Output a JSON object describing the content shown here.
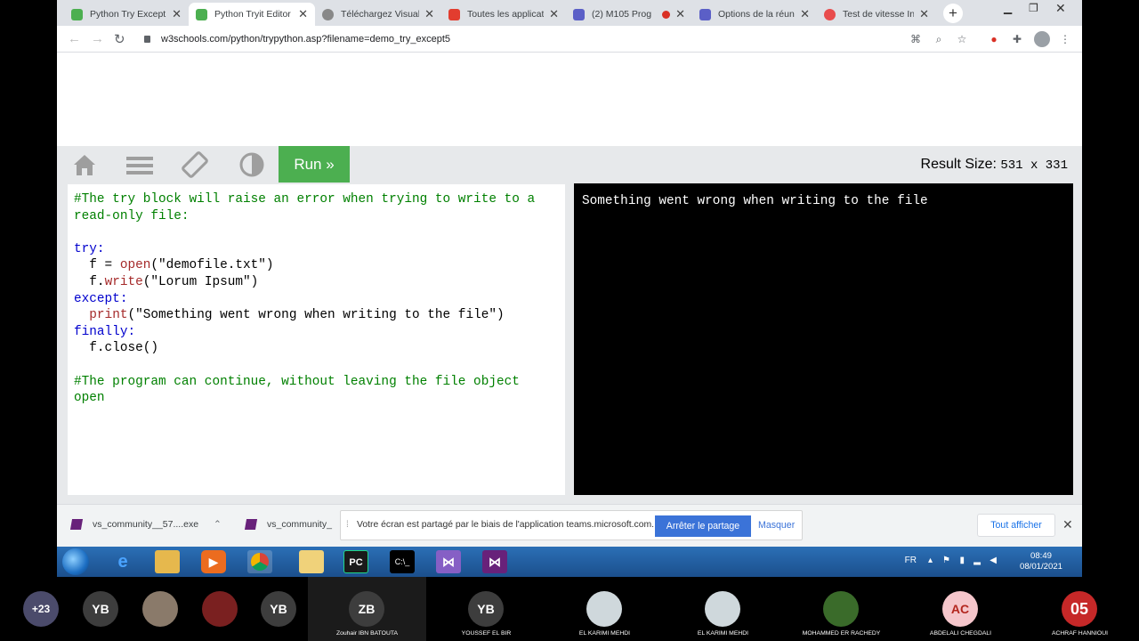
{
  "browser": {
    "tabs": [
      {
        "title": "Python Try Except",
        "color": "#4caf50"
      },
      {
        "title": "Python Tryit Editor",
        "color": "#4caf50",
        "active": true
      },
      {
        "title": "Téléchargez Visual",
        "color": "#888888"
      },
      {
        "title": "Toutes les applicati",
        "color": "#e23d2f"
      },
      {
        "title": "(2) M105 Prog",
        "color": "#5b5fc7"
      },
      {
        "title": "Options de la réuni",
        "color": "#5b5fc7"
      },
      {
        "title": "Test de vitesse Inte",
        "color": "#e84c4c"
      }
    ],
    "url": "w3schools.com/python/trypython.asp?filename=demo_try_except5"
  },
  "editor": {
    "run_label": "Run »",
    "result_size_label": "Result Size:",
    "result_size_value": "531 x 331",
    "code_lines": {
      "l1": "#The try block will raise an error when trying to write to a",
      "l2": "read-only file:",
      "l3": "try:",
      "l4a": "f = ",
      "l4b": "open",
      "l4c": "(\"demofile.txt\")",
      "l5a": "f.",
      "l5b": "write",
      "l5c": "(\"Lorum Ipsum\")",
      "l6": "except:",
      "l7a": "print",
      "l7b": "(\"Something went wrong when writing to the file\")",
      "l8": "finally:",
      "l9": "f.close()",
      "l10": "#The program can continue, without leaving the file object",
      "l11": "open"
    },
    "result_output": "Something went wrong when writing to the file"
  },
  "downloads": {
    "item1": "vs_community__57....exe",
    "item2": "vs_community_",
    "teams_notice": "Votre écran est partagé par le biais de l'application teams.microsoft.com.",
    "stop_sharing": "Arrêter le partage",
    "hide": "Masquer",
    "show_all": "Tout afficher"
  },
  "taskbar": {
    "lang": "FR",
    "time": "08:49",
    "date": "08/01/2021"
  },
  "participants": [
    {
      "initials": "+23",
      "name": "",
      "color": "#4b4b6b"
    },
    {
      "initials": "YB",
      "name": "",
      "color": "#3d3d3d"
    },
    {
      "initials": "",
      "name": "",
      "color": "#8a7a6a"
    },
    {
      "initials": "",
      "name": "",
      "color": "#7a2020"
    },
    {
      "initials": "YB",
      "name": "",
      "color": "#3d3d3d"
    },
    {
      "initials": "ZB",
      "name": "Zouhair IBN BATOUTA",
      "color": "#3d3d3d"
    },
    {
      "initials": "YB",
      "name": "YOUSSEF EL BIR",
      "color": "#3d3d3d"
    },
    {
      "initials": "",
      "name": "EL KARIMI MEHDI",
      "color": "#cfd8dc"
    },
    {
      "initials": "",
      "name": "EL KARIMI MEHDI",
      "color": "#cfd8dc"
    },
    {
      "initials": "",
      "name": "MOHAMMED ER RACHEDY",
      "color": "#3a6b2a"
    },
    {
      "initials": "AC",
      "name": "ABDELALI CHEGDALI",
      "color": "#f5c6cb"
    },
    {
      "initials": "05",
      "name": "ACHRAF HANNIOUI",
      "color": "#c62828"
    }
  ]
}
